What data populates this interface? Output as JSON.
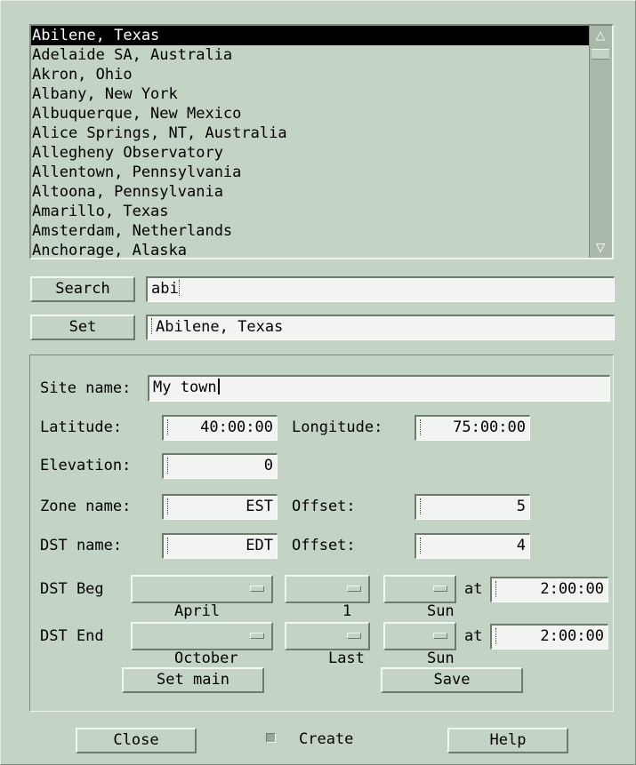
{
  "sites": {
    "items": [
      "Abilene, Texas",
      "Adelaide SA, Australia",
      "Akron, Ohio",
      "Albany, New York",
      "Albuquerque, New Mexico",
      "Alice Springs, NT, Australia",
      "Allegheny Observatory",
      "Allentown, Pennsylvania",
      "Altoona, Pennsylvania",
      "Amarillo, Texas",
      "Amsterdam, Netherlands",
      "Anchorage, Alaska"
    ],
    "selected_index": 0
  },
  "search": {
    "button_label": "Search",
    "value": "abi"
  },
  "set": {
    "button_label": "Set",
    "value": "Abilene, Texas"
  },
  "site": {
    "name_label": "Site name:",
    "name_value": "My town",
    "latitude_label": "Latitude:",
    "latitude_value": "40:00:00",
    "longitude_label": "Longitude:",
    "longitude_value": "75:00:00",
    "elevation_label": "Elevation:",
    "elevation_value": "0",
    "zone_name_label": "Zone name:",
    "zone_name_value": "EST",
    "zone_offset_label": "Offset:",
    "zone_offset_value": "5",
    "dst_name_label": "DST name:",
    "dst_name_value": "EDT",
    "dst_offset_label": "Offset:",
    "dst_offset_value": "4"
  },
  "dst_begin": {
    "label": "DST Beg",
    "month": "April",
    "week": "1",
    "day": "Sun",
    "at_label": "at",
    "time": "2:00:00"
  },
  "dst_end": {
    "label": "DST End",
    "month": "October",
    "week": "Last",
    "day": "Sun",
    "at_label": "at",
    "time": "2:00:00"
  },
  "actions": {
    "set_main_label": "Set main",
    "save_label": "Save"
  },
  "footer": {
    "close_label": "Close",
    "create_label": "Create",
    "help_label": "Help"
  },
  "colors": {
    "background": "#c4d4c4",
    "field": "#f2f4f2",
    "selection": "#000000"
  }
}
